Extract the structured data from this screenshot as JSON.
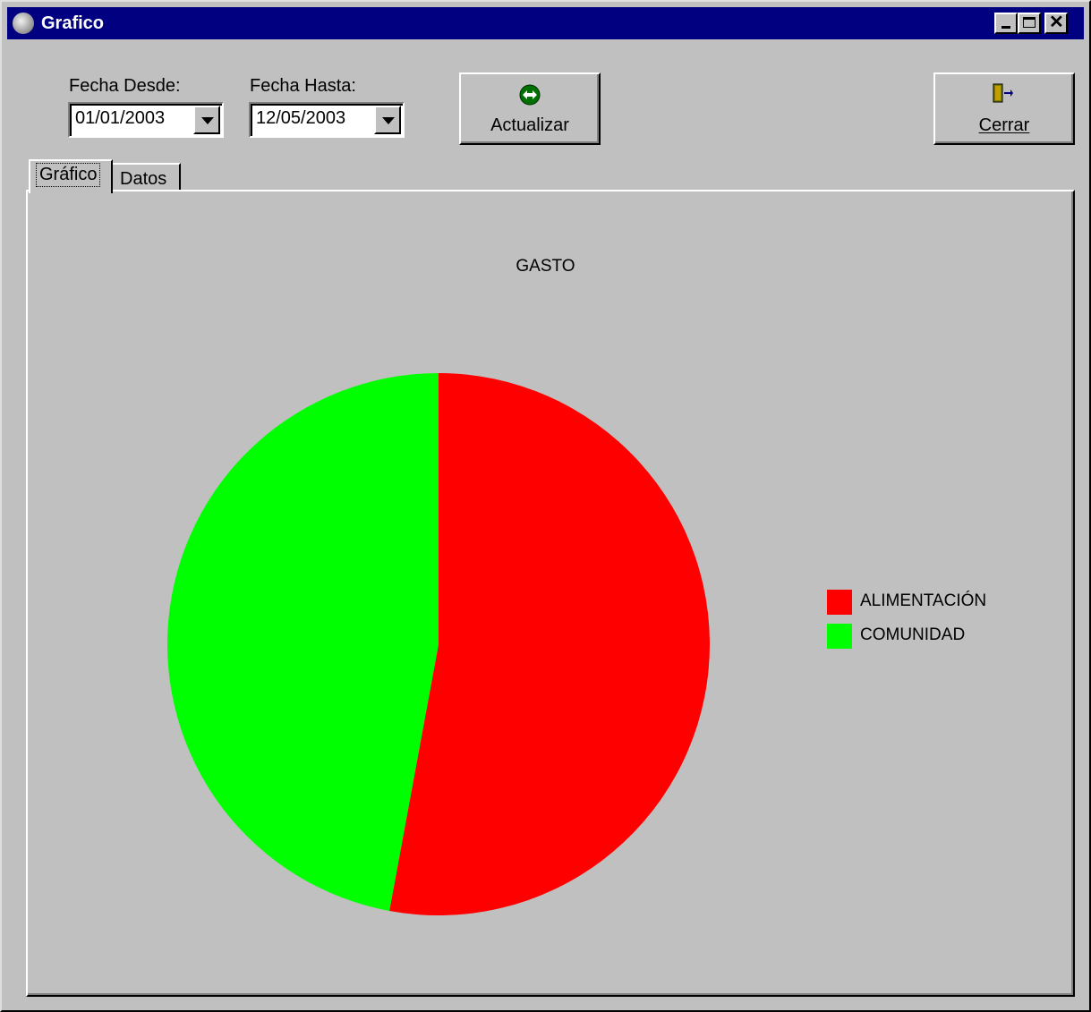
{
  "window": {
    "title": "Grafico"
  },
  "filters": {
    "from_label": "Fecha Desde:",
    "from_value": "01/01/2003",
    "to_label": "Fecha Hasta:",
    "to_value": "12/05/2003"
  },
  "buttons": {
    "refresh": "Actualizar",
    "close": "Cerrar"
  },
  "tabs": [
    {
      "label": "Gráfico",
      "active": true
    },
    {
      "label": "Datos",
      "active": false
    }
  ],
  "colors": {
    "face": "#c0c0c0",
    "title_bar": "#000080"
  },
  "icons": {
    "app": "app-icon",
    "refresh": "refresh-arrows-icon",
    "close": "door-exit-icon"
  },
  "chart_data": {
    "type": "pie",
    "title": "GASTO",
    "slices": [
      {
        "label": "ALIMENTACIÓN",
        "value": 52.9,
        "color": "#ff0000"
      },
      {
        "label": "COMUNIDAD",
        "value": 47.1,
        "color": "#00ff00"
      }
    ],
    "legend_position": "right"
  }
}
